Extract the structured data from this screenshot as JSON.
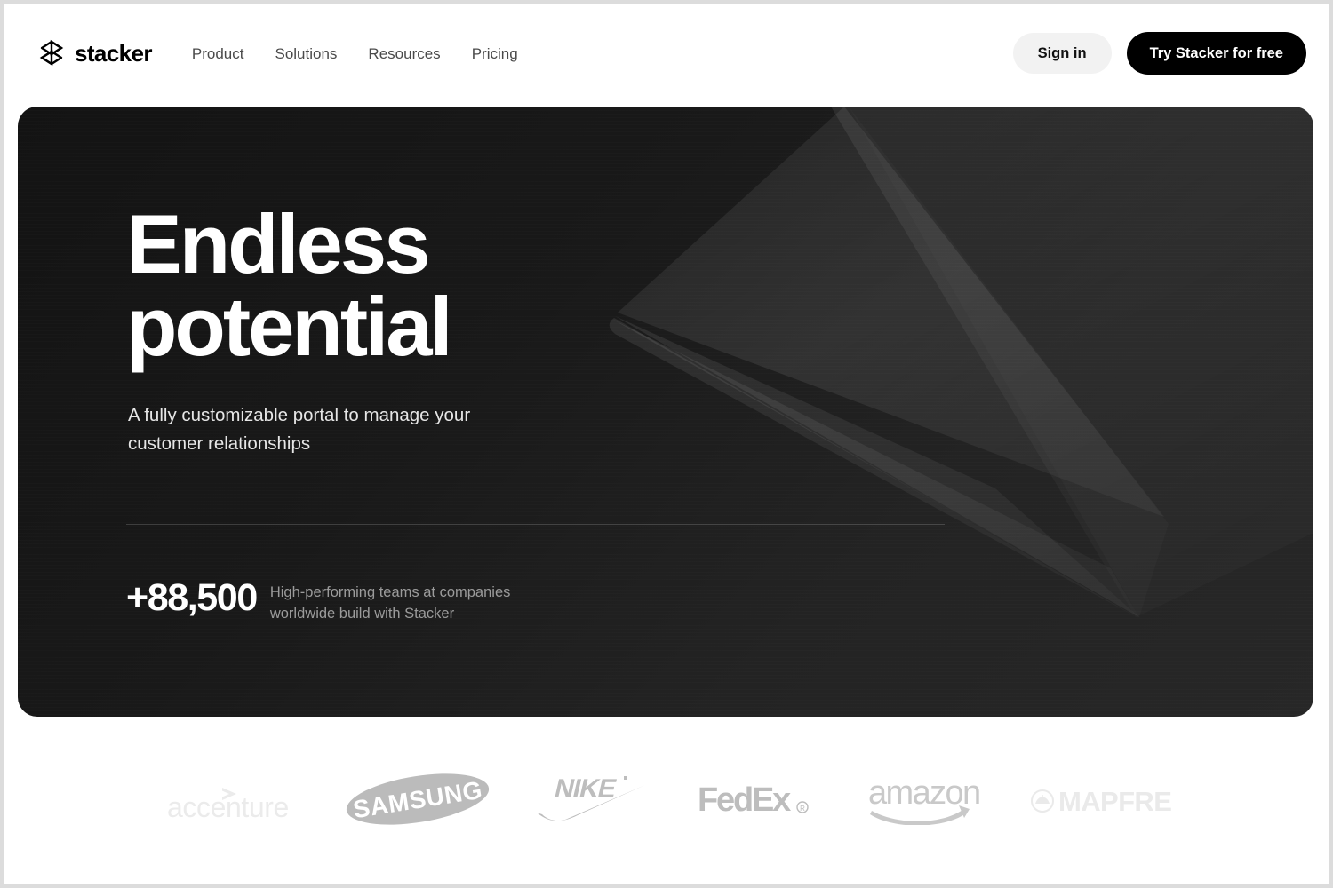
{
  "brand": {
    "name": "stacker",
    "mark_icon": "stacker-logo-icon"
  },
  "nav": {
    "items": [
      {
        "label": "Product"
      },
      {
        "label": "Solutions"
      },
      {
        "label": "Resources"
      },
      {
        "label": "Pricing"
      }
    ]
  },
  "header_actions": {
    "signin_label": "Sign in",
    "trial_label": "Try Stacker for free"
  },
  "hero": {
    "title": "Endless\npotential",
    "subtitle": "A fully customizable portal to manage your customer relationships",
    "stat_value": "+88,500",
    "stat_caption": "High-performing teams at companies worldwide build with Stacker"
  },
  "logos": [
    {
      "name": "accenture",
      "label": "accenture"
    },
    {
      "name": "samsung",
      "label": "SAMSUNG"
    },
    {
      "name": "nike",
      "label": "NIKE"
    },
    {
      "name": "fedex",
      "label": "FedEx"
    },
    {
      "name": "amazon",
      "label": "amazon"
    },
    {
      "name": "mapfre",
      "label": "MAPFRE"
    }
  ],
  "colors": {
    "page_background": "#ffffff",
    "page_frame": "#dcdcdc",
    "hero_dark_start": "#131313",
    "hero_dark_end": "#272727",
    "accent_black": "#000000",
    "signin_pill": "#f2f2f2",
    "nav_text": "#4a4a4a",
    "hero_title_text": "#ffffff",
    "hero_subtitle_text": "#e6e6e6",
    "stat_caption_text": "#9b9b9b",
    "logo_gray": "#bdbdbd",
    "logo_gray_light": "#e8e8e8"
  }
}
